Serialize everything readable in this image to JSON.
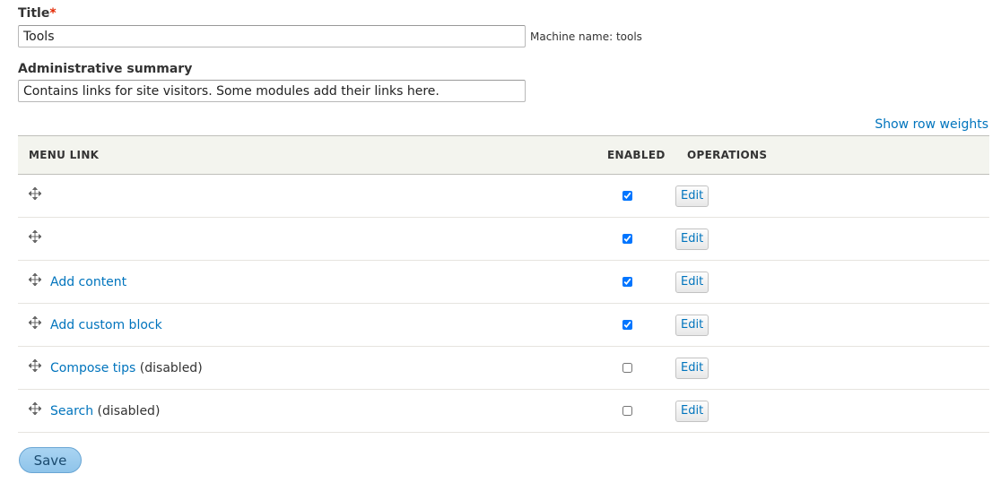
{
  "form": {
    "title_label": "Title",
    "required_marker": "*",
    "title_value": "Tools",
    "machine_name_prefix": "Machine name: ",
    "machine_name": "tools",
    "summary_label": "Administrative summary",
    "summary_value": "Contains links for site visitors. Some modules add their links here."
  },
  "table": {
    "show_row_weights": "Show row weights",
    "headers": {
      "menu_link": "MENU LINK",
      "enabled": "ENABLED",
      "operations": "OPERATIONS"
    },
    "rows": [
      {
        "title": "",
        "note": "",
        "enabled": true,
        "operation": "Edit"
      },
      {
        "title": "",
        "note": "",
        "enabled": true,
        "operation": "Edit"
      },
      {
        "title": "Add content",
        "note": "",
        "enabled": true,
        "operation": "Edit"
      },
      {
        "title": "Add custom block",
        "note": "",
        "enabled": true,
        "operation": "Edit"
      },
      {
        "title": "Compose tips",
        "note": " (disabled)",
        "enabled": false,
        "operation": "Edit"
      },
      {
        "title": "Search",
        "note": " (disabled)",
        "enabled": false,
        "operation": "Edit"
      }
    ]
  },
  "actions": {
    "save_label": "Save"
  },
  "colors": {
    "link": "#0074bd",
    "required": "#e32700",
    "header_bg": "#f3f4ee",
    "save_bg": "#9ccbee"
  }
}
